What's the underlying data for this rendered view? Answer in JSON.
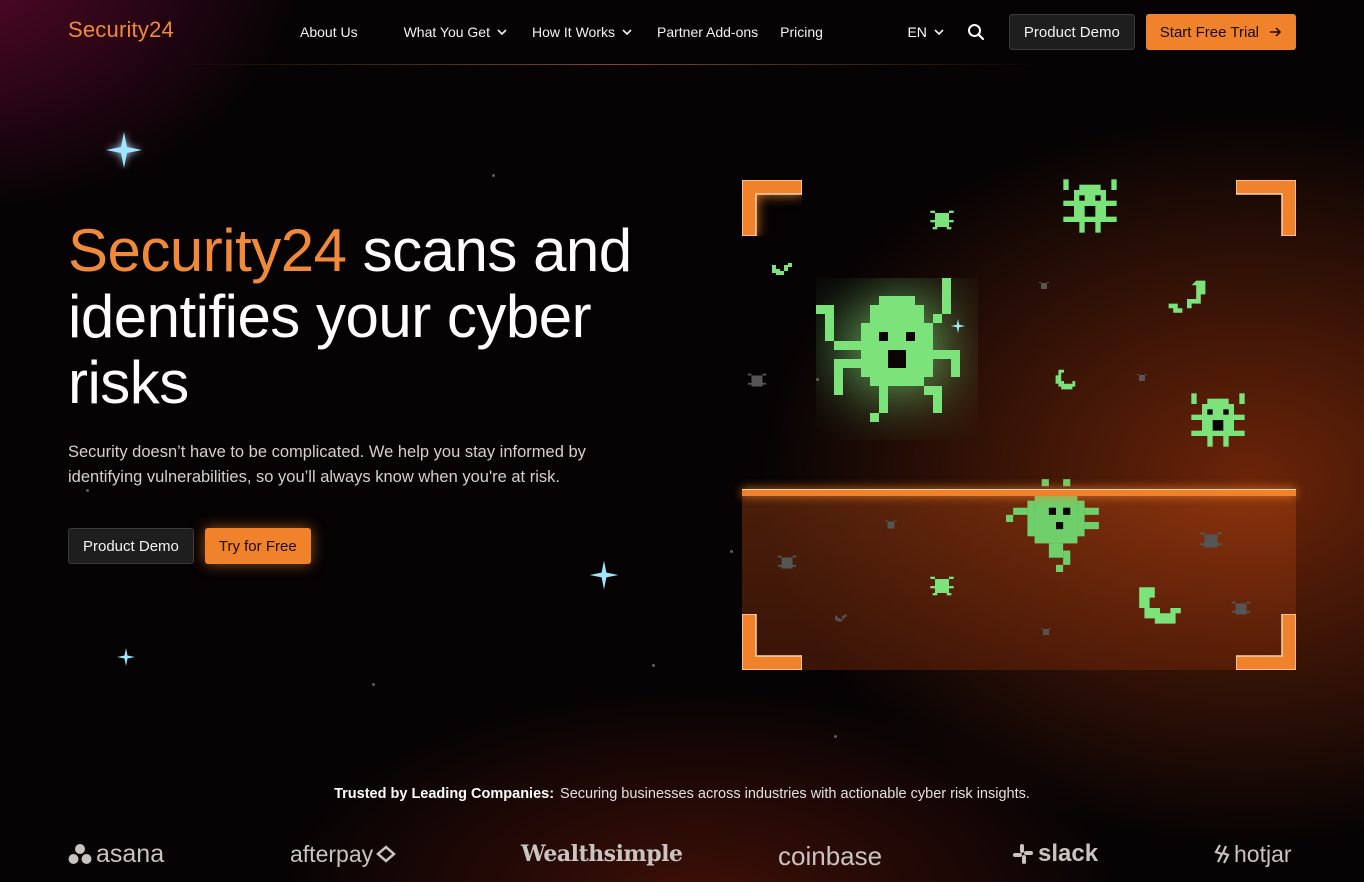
{
  "nav": {
    "logo": "Security24",
    "links": [
      {
        "label": "About Us",
        "has_dropdown": false
      },
      {
        "label": "What You Get",
        "has_dropdown": true
      },
      {
        "label": "How It Works",
        "has_dropdown": true
      },
      {
        "label": "Partner Add-ons",
        "has_dropdown": false
      },
      {
        "label": "Pricing",
        "has_dropdown": false
      }
    ],
    "language": "EN",
    "demo_label": "Product Demo",
    "trial_label": "Start Free Trial"
  },
  "hero": {
    "title_brand": "Security24",
    "title_line1_rest": " scans and",
    "title_line2": "identifies your cyber",
    "title_line3": "risks",
    "subtitle": "Security doesn’t have to be complicated. We help you stay informed by identifying vulnerabilities, so you’ll always know when you're at risk.",
    "demo_label": "Product Demo",
    "try_label": "Try for Free"
  },
  "trust": {
    "label": "Trusted by Leading Companies:",
    "text": "Securing businesses across industries with actionable cyber risk insights."
  },
  "companies": [
    "asana",
    "afterpay",
    "Wealthsimple",
    "coinbase",
    "slack",
    "hotjar"
  ],
  "colors": {
    "accent": "#f0822b",
    "bug_green": "#7be37a",
    "bug_gray": "#555555",
    "sparkle": "#9fe6ff"
  }
}
